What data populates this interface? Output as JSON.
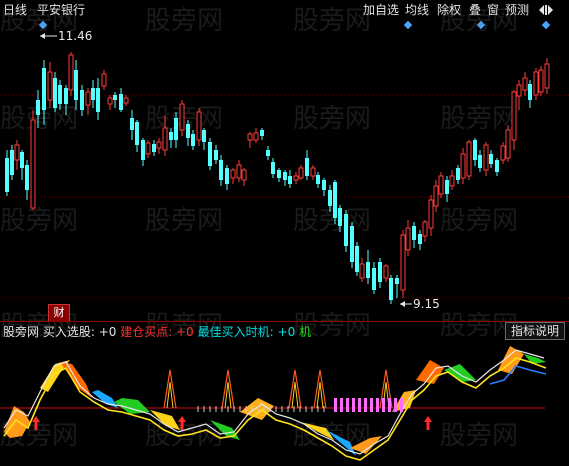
{
  "header": {
    "period": "日线",
    "stock_name": "平安银行",
    "buttons": [
      "加自选",
      "均线",
      "除权",
      "叠",
      "窗",
      "预测"
    ],
    "nav_icon": "arrow-left-right-icon"
  },
  "watermark": "股旁网",
  "price": {
    "high_label": "11.46",
    "low_label": "9.15",
    "finance_badge": "财"
  },
  "indicator": {
    "legend": [
      {
        "text": "股旁网",
        "color": "#e6e6e6"
      },
      {
        "text": "买入选股:",
        "color": "#e6e6e6"
      },
      {
        "text": "+0",
        "color": "#e6e6e6"
      },
      {
        "text": "建仓买点:",
        "color": "#ff3030"
      },
      {
        "text": "+0",
        "color": "#ff3030"
      },
      {
        "text": "最佳买入时机:",
        "color": "#00e0e0"
      },
      {
        "text": "+0",
        "color": "#00e0e0"
      },
      {
        "text": "机",
        "color": "#22dd22"
      }
    ],
    "help_button": "指标说明"
  },
  "colors": {
    "background": "#000000",
    "up_candle": "#ff3b3b",
    "down_candle": "#54ffff",
    "ma_line": "#e8e8e8",
    "grid": "#6b0000",
    "accent": "#4aa3ff"
  }
}
